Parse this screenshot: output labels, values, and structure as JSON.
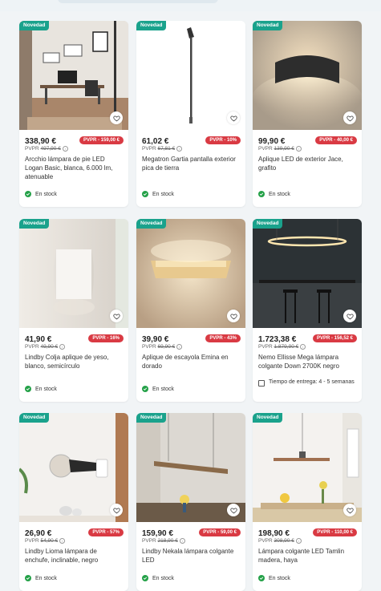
{
  "labels": {
    "new_badge": "Novedad",
    "pvpr_prefix": "PVPR"
  },
  "products": [
    {
      "name": "Arcchio lámpara de pie LED Logan Basic, blanca, 6.000 lm, atenuable",
      "price": "338,90 €",
      "old_price": "497,90 €",
      "discount": "PVPR - 159,00 €",
      "status": "En stock",
      "new": true
    },
    {
      "name": "Megatron Gartia pantalla exterior pica de tierra",
      "price": "61,02 €",
      "old_price": "67,81 €",
      "discount": "PVPR - 10%",
      "status": "En stock",
      "new": true
    },
    {
      "name": "Aplique LED de exterior Jace, grafito",
      "price": "99,90 €",
      "old_price": "139,90 €",
      "discount": "PVPR - 40,00 €",
      "status": "En stock",
      "new": true
    },
    {
      "name": "Lindby Colja aplique de yeso, blanco, semicírculo",
      "price": "41,90 €",
      "old_price": "49,90 €",
      "discount": "PVPR - 16%",
      "status": "En stock",
      "new": true
    },
    {
      "name": "Aplique de escayola Emina en dorado",
      "price": "39,90 €",
      "old_price": "69,90 €",
      "discount": "PVPR - 43%",
      "status": "En stock",
      "new": true
    },
    {
      "name": "Nemo Ellisse Mega lámpara colgante Down 2700K negro",
      "price": "1.723,38 €",
      "old_price": "1.879,90 €",
      "discount": "PVPR - 156,52 €",
      "status": "Tiempo de entrega: 4 - 5 semanas",
      "new": true
    },
    {
      "name": "Lindby Lioma lámpara de enchufe, inclinable, negro",
      "price": "26,90 €",
      "old_price": "54,90 €",
      "discount": "PVPR - 57%",
      "status": "En stock",
      "new": true
    },
    {
      "name": "Lindby Nekala lámpara colgante LED",
      "price": "159,90 €",
      "old_price": "218,90 €",
      "discount": "PVPR - 59,00 €",
      "status": "En stock",
      "new": true
    },
    {
      "name": "Lámpara colgante LED Tamlin madera, haya",
      "price": "198,90 €",
      "old_price": "308,90 €",
      "discount": "PVPR - 110,00 €",
      "status": "En stock",
      "new": true
    }
  ],
  "colors": {
    "new_badge": "#1aa28c",
    "discount": "#d93a43",
    "in_stock": "#24a148"
  },
  "icons": {
    "favorite": "heart-icon",
    "stock": "check-circle-icon",
    "delivery": "truck-icon",
    "info": "info-icon"
  }
}
